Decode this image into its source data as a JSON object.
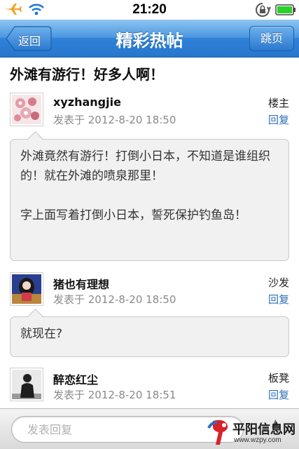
{
  "status_bar": {
    "time": "21:20",
    "icons": [
      "airplane-icon",
      "wifi-icon",
      "rotation-lock-icon",
      "battery-icon"
    ]
  },
  "nav": {
    "back_label": "返回",
    "title": "精彩热帖",
    "jump_label": "跳页"
  },
  "thread": {
    "title": "外滩有游行！好多人啊！"
  },
  "posts": [
    {
      "username": "xyzhangjie",
      "time": "发表于 2012-8-20 18:50",
      "floor": "楼主",
      "reply": "回复",
      "content": [
        "外滩竟然有游行！打倒小日本，不知道是谁组织的！就在外滩的喷泉那里！",
        "字上面写着打倒小日本，誓死保护钓鱼岛！"
      ]
    },
    {
      "username": "猪也有理想",
      "time": "发表于 2012-8-20 18:50",
      "floor": "沙发",
      "reply": "回复",
      "content": [
        "就现在?"
      ]
    },
    {
      "username": "醉恋红尘",
      "time": "发表于 2012-8-20 18:51",
      "floor": "板凳",
      "reply": "回复",
      "content": []
    }
  ],
  "bottom": {
    "reply_placeholder": "发表回复"
  },
  "watermark": {
    "name": "平阳信息网",
    "url": "www.wzpy.com"
  },
  "colors": {
    "nav_blue": "#2f82d8",
    "link_blue": "#2c6fb8",
    "bubble_bg": "#f1f1f1",
    "time_gray": "#8a8a8a",
    "battery_green": "#2bd12b"
  }
}
